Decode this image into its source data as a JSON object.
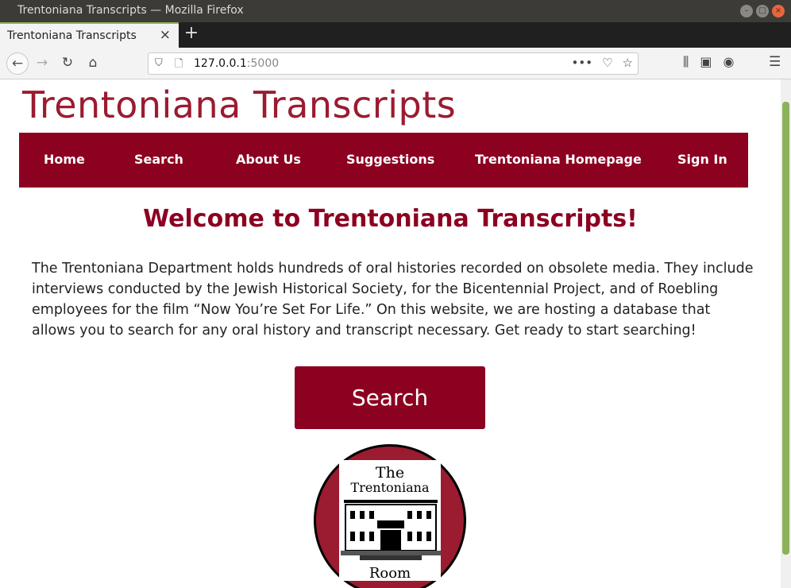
{
  "window": {
    "title": "Trentoniana Transcripts — Mozilla Firefox",
    "buttons": [
      "–",
      "□",
      "×"
    ]
  },
  "tab": {
    "label": "Trentoniana Transcripts",
    "close": "×",
    "new_tab": "+"
  },
  "urlbar": {
    "host": "127.0.0.1",
    "port": ":5000"
  },
  "site": {
    "title": "Trentoniana Transcripts",
    "nav": [
      "Home",
      "Search",
      "About Us",
      "Suggestions",
      "Trentoniana Homepage",
      "Sign In"
    ],
    "welcome": "Welcome to Trentoniana Transcripts!",
    "intro": "The Trentoniana Department holds hundreds of oral histories recorded on obsolete media. They include interviews conducted by the Jewish Historical Society, for the Bicentennial Project, and of Roebling employees for the film “Now You’re Set For Life.” On this website, we are hosting a database that allows you to search for any oral history and transcript necessary. Get ready to start searching!",
    "search_button": "Search",
    "logo": {
      "top": "The",
      "middle": "Trentoniana",
      "bottom": "Room"
    }
  },
  "colors": {
    "brand": "#8c0020",
    "title": "#9b1b30",
    "tab_accent": "#8bb259"
  }
}
